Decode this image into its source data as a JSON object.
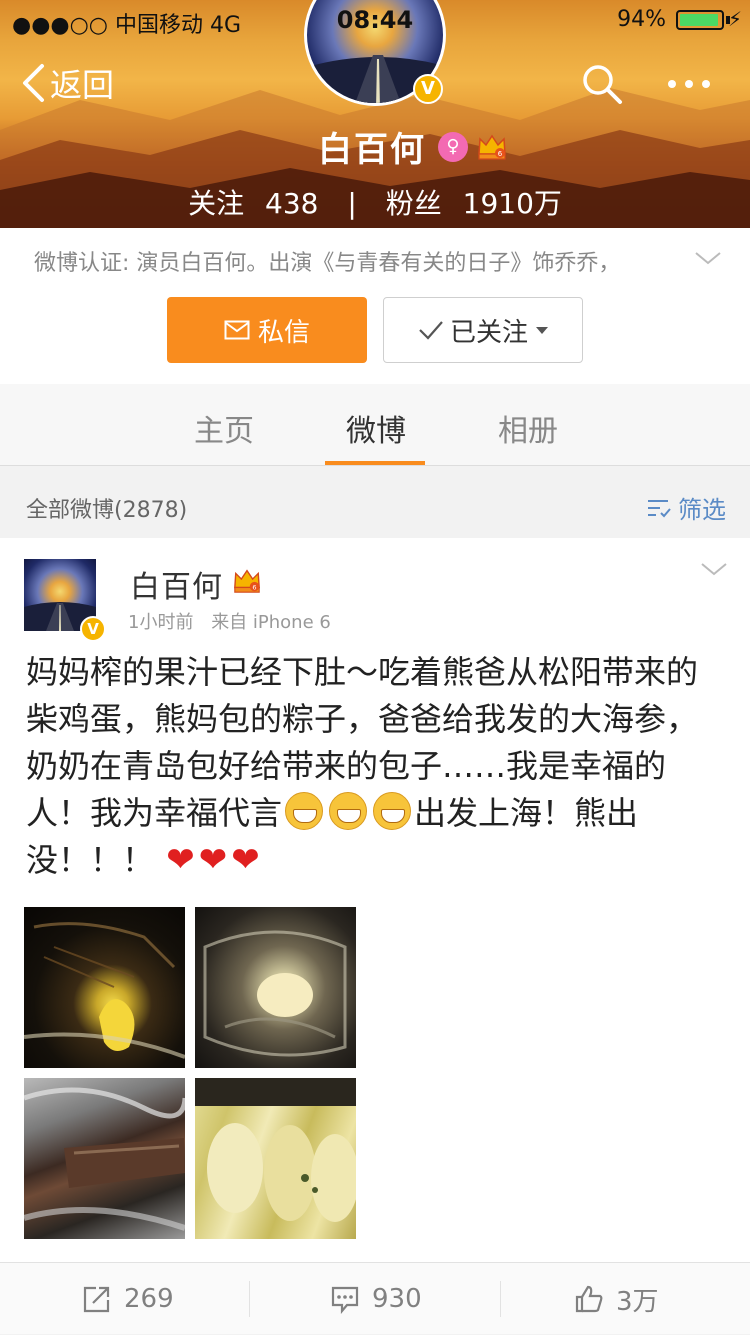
{
  "status_bar": {
    "carrier": "●●●○○ 中国移动 4G",
    "time": "08:44",
    "battery": "94%",
    "battery_level": 0.94
  },
  "nav": {
    "back_label": "返回"
  },
  "profile": {
    "name": "白百何",
    "verify_mark": "V",
    "follow_label": "关注",
    "follow_count": "438",
    "stat_separator": "|",
    "fans_label": "粉丝",
    "fans_count": "1910万",
    "verification": "微博认证: 演员白百何。出演《与青春有关的日子》饰乔乔，"
  },
  "buttons": {
    "message": "私信",
    "followed": "已关注"
  },
  "tabs": [
    {
      "label": "主页",
      "active": false
    },
    {
      "label": "微博",
      "active": true
    },
    {
      "label": "相册",
      "active": false
    }
  ],
  "filter": {
    "all_label": "全部微博(2878)",
    "filter_label": "筛选"
  },
  "post": {
    "author": "白百何",
    "verify_mark": "V",
    "time": "1小时前",
    "source": "来自 iPhone 6",
    "text_part1": "妈妈榨的果汁已经下肚～吃着熊爸从松阳带来的柴鸡蛋，熊妈包的粽子，爸爸给我发的大海参，奶奶在青岛包好给带来的包子……我是幸福的人！我为幸福代言",
    "text_part2": "出发上海！熊出没！！！",
    "hearts": [
      "❤",
      "❤",
      "❤"
    ],
    "images": [
      "photo-1",
      "photo-2",
      "photo-3",
      "photo-4"
    ]
  },
  "actions": {
    "repost_count": "269",
    "comment_count": "930",
    "like_count": "3万"
  },
  "colors": {
    "accent": "#f98c1e",
    "link": "#5b8bc6",
    "verify": "#f6b400"
  }
}
